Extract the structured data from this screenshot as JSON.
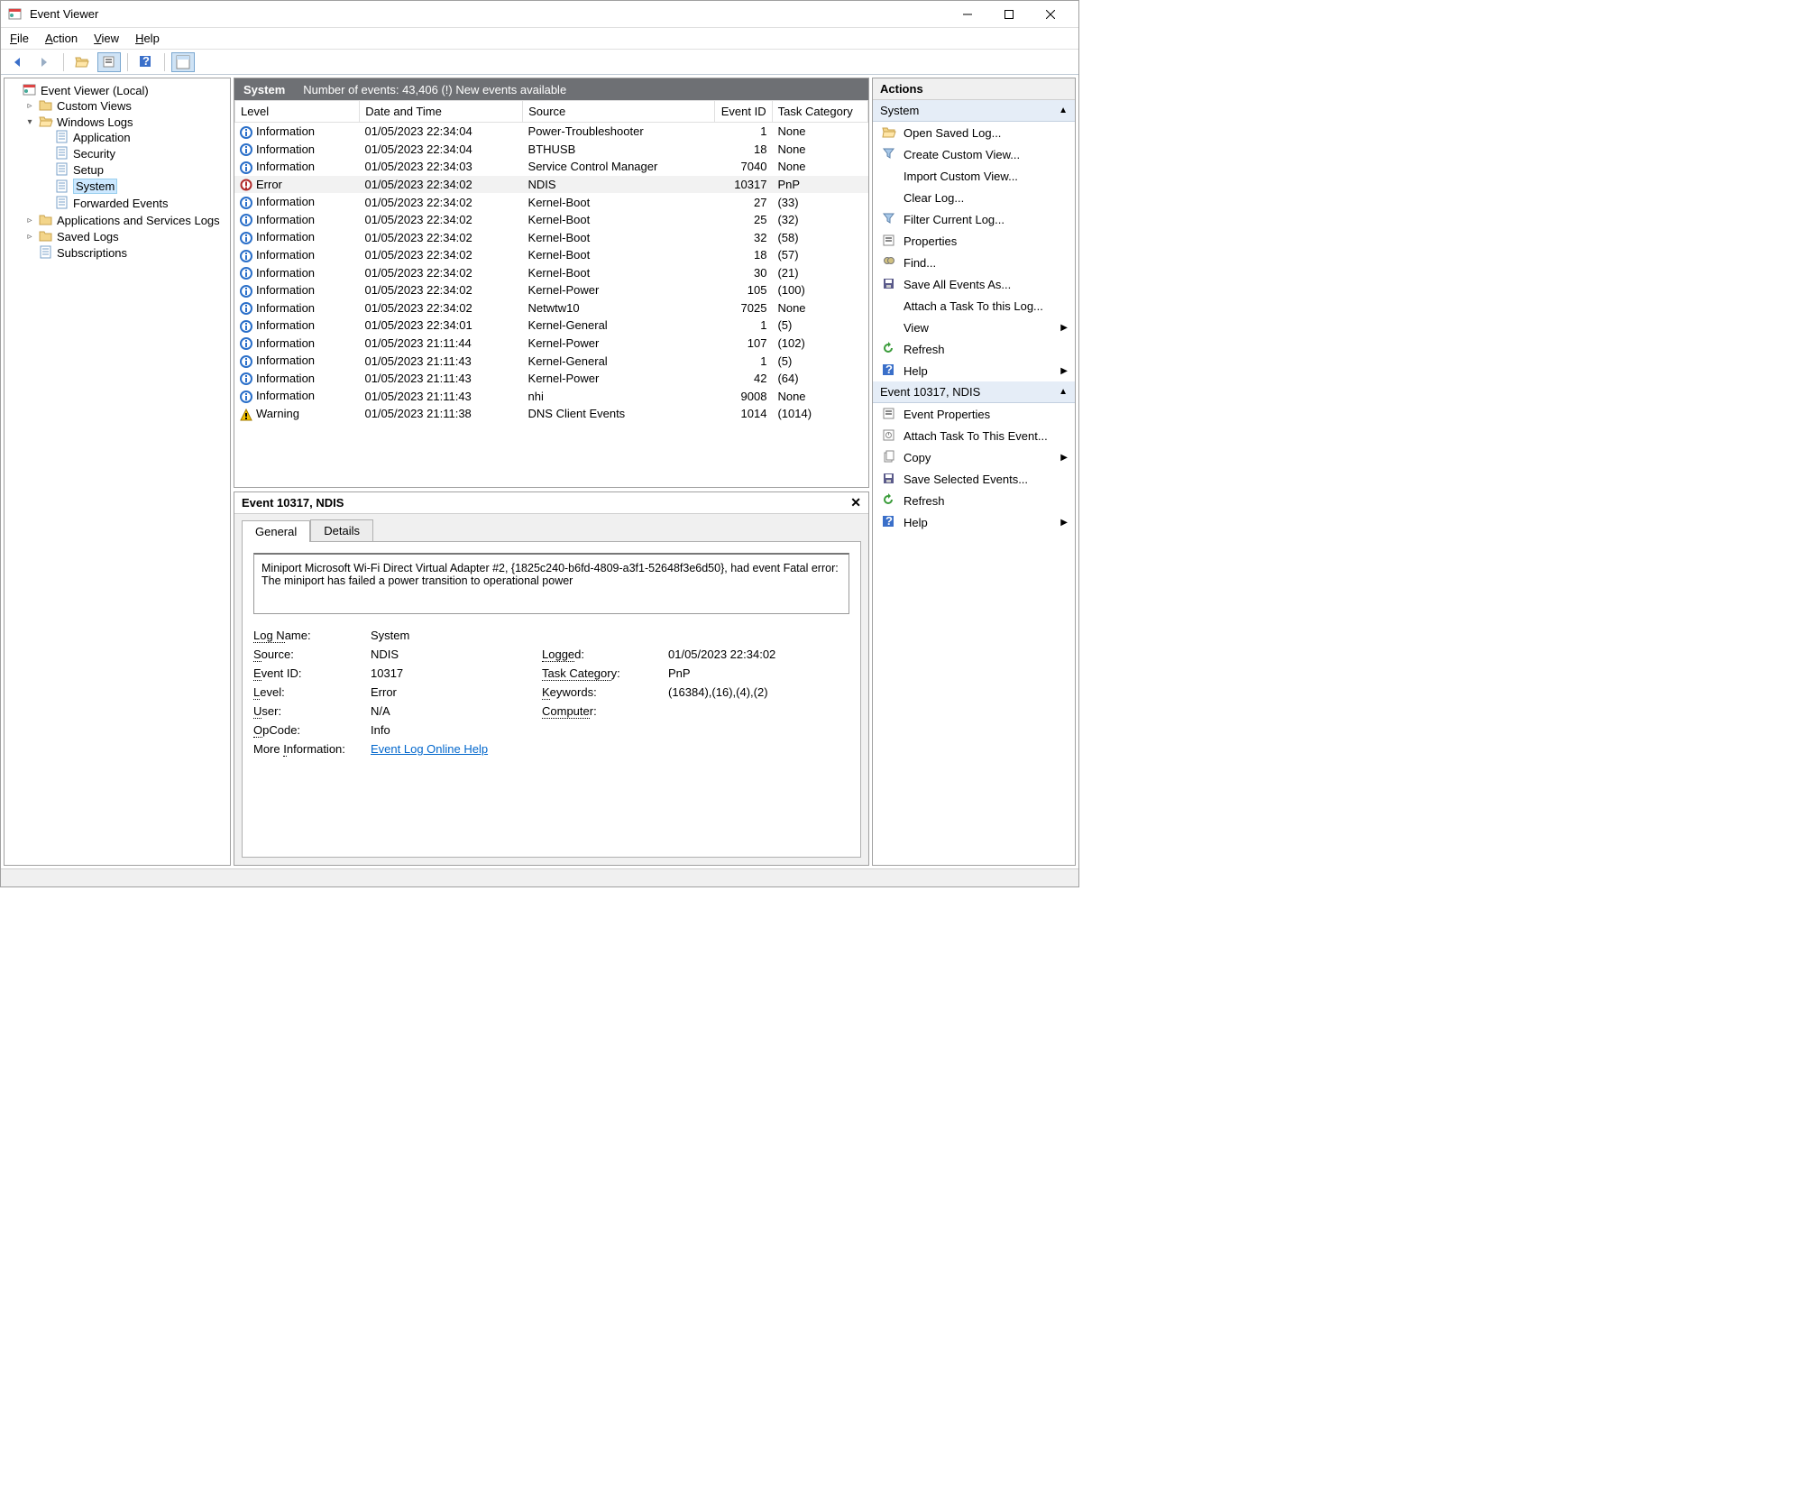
{
  "window": {
    "title": "Event Viewer"
  },
  "menu": {
    "file": "File",
    "action": "Action",
    "view": "View",
    "help": "Help"
  },
  "tree": {
    "root": "Event Viewer (Local)",
    "custom_views": "Custom Views",
    "windows_logs": "Windows Logs",
    "logs": {
      "application": "Application",
      "security": "Security",
      "setup": "Setup",
      "system": "System",
      "forwarded": "Forwarded Events"
    },
    "apps_services": "Applications and Services Logs",
    "saved_logs": "Saved Logs",
    "subscriptions": "Subscriptions"
  },
  "listhdr": {
    "title": "System",
    "count": "Number of events: 43,406 (!) New events available"
  },
  "cols": {
    "level": "Level",
    "dt": "Date and Time",
    "src": "Source",
    "id": "Event ID",
    "tc": "Task Category"
  },
  "rows": [
    {
      "level": "Information",
      "dt": "01/05/2023 22:34:04",
      "src": "Power-Troubleshooter",
      "id": "1",
      "tc": "None",
      "sel": false,
      "icon": "info"
    },
    {
      "level": "Information",
      "dt": "01/05/2023 22:34:04",
      "src": "BTHUSB",
      "id": "18",
      "tc": "None",
      "sel": false,
      "icon": "info"
    },
    {
      "level": "Information",
      "dt": "01/05/2023 22:34:03",
      "src": "Service Control Manager",
      "id": "7040",
      "tc": "None",
      "sel": false,
      "icon": "info"
    },
    {
      "level": "Error",
      "dt": "01/05/2023 22:34:02",
      "src": "NDIS",
      "id": "10317",
      "tc": "PnP",
      "sel": true,
      "icon": "error"
    },
    {
      "level": "Information",
      "dt": "01/05/2023 22:34:02",
      "src": "Kernel-Boot",
      "id": "27",
      "tc": "(33)",
      "sel": false,
      "icon": "info"
    },
    {
      "level": "Information",
      "dt": "01/05/2023 22:34:02",
      "src": "Kernel-Boot",
      "id": "25",
      "tc": "(32)",
      "sel": false,
      "icon": "info"
    },
    {
      "level": "Information",
      "dt": "01/05/2023 22:34:02",
      "src": "Kernel-Boot",
      "id": "32",
      "tc": "(58)",
      "sel": false,
      "icon": "info"
    },
    {
      "level": "Information",
      "dt": "01/05/2023 22:34:02",
      "src": "Kernel-Boot",
      "id": "18",
      "tc": "(57)",
      "sel": false,
      "icon": "info"
    },
    {
      "level": "Information",
      "dt": "01/05/2023 22:34:02",
      "src": "Kernel-Boot",
      "id": "30",
      "tc": "(21)",
      "sel": false,
      "icon": "info"
    },
    {
      "level": "Information",
      "dt": "01/05/2023 22:34:02",
      "src": "Kernel-Power",
      "id": "105",
      "tc": "(100)",
      "sel": false,
      "icon": "info"
    },
    {
      "level": "Information",
      "dt": "01/05/2023 22:34:02",
      "src": "Netwtw10",
      "id": "7025",
      "tc": "None",
      "sel": false,
      "icon": "info"
    },
    {
      "level": "Information",
      "dt": "01/05/2023 22:34:01",
      "src": "Kernel-General",
      "id": "1",
      "tc": "(5)",
      "sel": false,
      "icon": "info"
    },
    {
      "level": "Information",
      "dt": "01/05/2023 21:11:44",
      "src": "Kernel-Power",
      "id": "107",
      "tc": "(102)",
      "sel": false,
      "icon": "info"
    },
    {
      "level": "Information",
      "dt": "01/05/2023 21:11:43",
      "src": "Kernel-General",
      "id": "1",
      "tc": "(5)",
      "sel": false,
      "icon": "info"
    },
    {
      "level": "Information",
      "dt": "01/05/2023 21:11:43",
      "src": "Kernel-Power",
      "id": "42",
      "tc": "(64)",
      "sel": false,
      "icon": "info"
    },
    {
      "level": "Information",
      "dt": "01/05/2023 21:11:43",
      "src": "nhi",
      "id": "9008",
      "tc": "None",
      "sel": false,
      "icon": "info"
    },
    {
      "level": "Warning",
      "dt": "01/05/2023 21:11:38",
      "src": "DNS Client Events",
      "id": "1014",
      "tc": "(1014)",
      "sel": false,
      "icon": "warn"
    }
  ],
  "detail": {
    "header": "Event 10317, NDIS",
    "tabs": {
      "general": "General",
      "details": "Details"
    },
    "message": "Miniport Microsoft Wi-Fi Direct Virtual Adapter #2, {1825c240-b6fd-4809-a3f1-52648f3e6d50}, had event Fatal error: The miniport has failed a power transition to operational power",
    "labels": {
      "logname": "Log Name:",
      "source": "Source:",
      "eventid": "Event ID:",
      "level": "Level:",
      "user": "User:",
      "opcode": "OpCode:",
      "logged": "Logged:",
      "task": "Task Category:",
      "keywords": "Keywords:",
      "computer": "Computer:",
      "moreinfo": "More Information:"
    },
    "values": {
      "logname": "System",
      "source": "NDIS",
      "eventid": "10317",
      "level": "Error",
      "user": "N/A",
      "opcode": "Info",
      "logged": "01/05/2023 22:34:02",
      "task": "PnP",
      "keywords": "(16384),(16),(4),(2)",
      "computer": "",
      "moreinfo": "Event Log Online Help"
    }
  },
  "actions": {
    "header": "Actions",
    "section1": "System",
    "items1": [
      "Open Saved Log...",
      "Create Custom View...",
      "Import Custom View...",
      "Clear Log...",
      "Filter Current Log...",
      "Properties",
      "Find...",
      "Save All Events As...",
      "Attach a Task To this Log...",
      "View",
      "Refresh",
      "Help"
    ],
    "section2": "Event 10317, NDIS",
    "items2": [
      "Event Properties",
      "Attach Task To This Event...",
      "Copy",
      "Save Selected Events...",
      "Refresh",
      "Help"
    ]
  }
}
